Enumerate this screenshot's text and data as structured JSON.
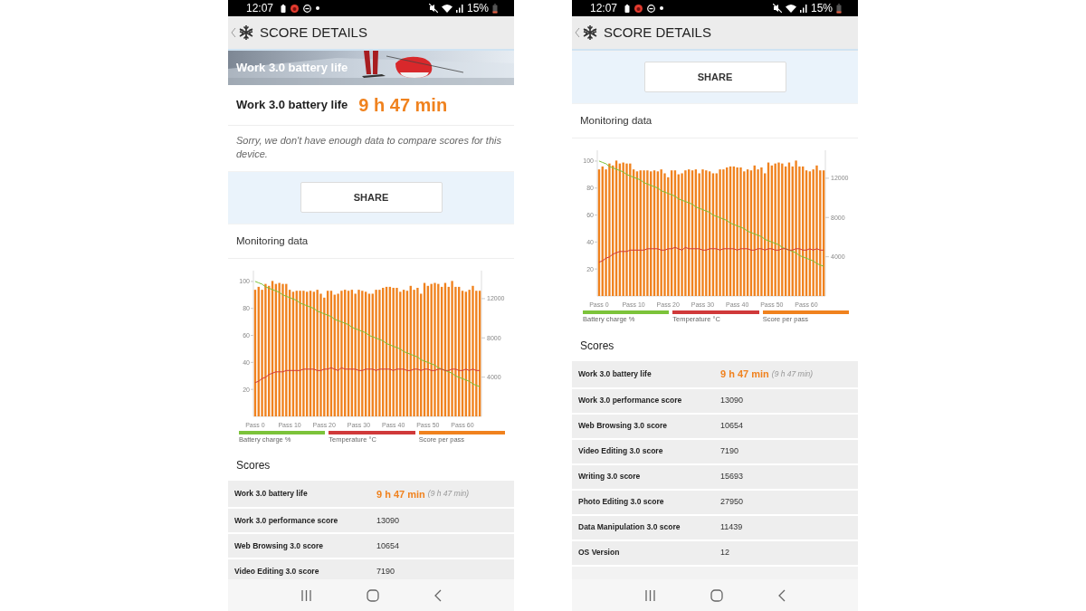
{
  "phones": [
    {
      "status_bar": {
        "time": "12:07",
        "battery": "15%"
      },
      "header": {
        "title": "SCORE DETAILS"
      },
      "sections": [
        {
          "kind": "banner",
          "title": "Work 3.0 battery life"
        },
        {
          "kind": "result",
          "label": "Work 3.0 battery life",
          "value": "9 h 47 min"
        },
        {
          "kind": "note",
          "text": "Sorry, we don't have enough data to compare scores for this device."
        },
        {
          "kind": "share",
          "button": "SHARE"
        },
        {
          "kind": "monitoring",
          "title": "Monitoring data",
          "chart_data": {
            "type": "bar",
            "categories": [
              "Pass 0",
              null,
              null,
              null,
              null,
              null,
              null,
              null,
              null,
              null,
              "Pass 10",
              null,
              null,
              null,
              null,
              null,
              null,
              null,
              null,
              null,
              "Pass 20",
              null,
              null,
              null,
              null,
              null,
              null,
              null,
              null,
              null,
              "Pass 30",
              null,
              null,
              null,
              null,
              null,
              null,
              null,
              null,
              null,
              "Pass 40",
              null,
              null,
              null,
              null,
              null,
              null,
              null,
              null,
              null,
              "Pass 50",
              null,
              null,
              null,
              null,
              null,
              null,
              null,
              null,
              null,
              "Pass 60",
              null,
              null,
              null,
              null,
              null
            ],
            "ylim": [
              0,
              108
            ],
            "yticks": [
              20,
              40,
              60,
              80,
              100
            ],
            "y2lim": [
              0,
              14850
            ],
            "y2ticks": [
              4000,
              8000,
              12000
            ],
            "series": [
              {
                "name": "Battery charge %",
                "color": "#7cc33a",
                "type": "line",
                "values": [
                  100,
                  99,
                  98,
                  96,
                  95,
                  94,
                  93,
                  92,
                  90,
                  89,
                  88,
                  87,
                  86,
                  84,
                  83,
                  82,
                  81,
                  80,
                  78,
                  77,
                  76,
                  75,
                  74,
                  72,
                  71,
                  70,
                  69,
                  68,
                  66,
                  65,
                  64,
                  63,
                  62,
                  60,
                  59,
                  58,
                  57,
                  56,
                  54,
                  53,
                  52,
                  51,
                  50,
                  48,
                  47,
                  46,
                  45,
                  44,
                  42,
                  41,
                  40,
                  39,
                  38,
                  36,
                  35,
                  34,
                  33,
                  32,
                  30,
                  29,
                  28,
                  27,
                  26,
                  24,
                  23,
                  22
                ]
              },
              {
                "name": "Temperature °C",
                "color": "#d0393a",
                "type": "line",
                "values": [
                  25,
                  26,
                  28,
                  29,
                  31,
                  32,
                  33,
                  33,
                  33,
                  34,
                  34,
                  34,
                  34,
                  34,
                  35,
                  35,
                  35,
                  35,
                  34,
                  34,
                  35,
                  35,
                  36,
                  35,
                  34,
                  36,
                  35,
                  35,
                  35,
                  35,
                  34,
                  34,
                  35,
                  35,
                  35,
                  34,
                  35,
                  35,
                  35,
                  35,
                  34,
                  35,
                  35,
                  35,
                  34,
                  34,
                  35,
                  35,
                  34,
                  35,
                  35,
                  34,
                  34,
                  35,
                  35,
                  34,
                  34,
                  35,
                  35,
                  34,
                  34,
                  35,
                  34,
                  35,
                  34,
                  34
                ]
              },
              {
                "name": "Score per pass",
                "color": "#f0821e",
                "type": "bar",
                "axis": "y2",
                "values": [
                  12900,
                  13200,
                  12900,
                  13500,
                  13300,
                  13800,
                  13500,
                  13600,
                  13500,
                  13500,
                  12900,
                  12700,
                  12800,
                  12800,
                  12800,
                  12700,
                  12800,
                  12700,
                  12900,
                  12500,
                  12100,
                  12800,
                  12800,
                  12400,
                  12500,
                  12800,
                  12900,
                  12800,
                  12900,
                  12500,
                  12900,
                  12800,
                  12700,
                  12500,
                  12500,
                  12900,
                  12900,
                  13100,
                  13200,
                  13200,
                  13100,
                  13100,
                  12700,
                  12900,
                  12800,
                  13300,
                  12900,
                  13100,
                  12500,
                  13600,
                  13300,
                  13500,
                  13600,
                  13500,
                  13200,
                  13600,
                  13200,
                  13800,
                  13200,
                  13200,
                  12800,
                  12700,
                  12900,
                  13300,
                  12800,
                  12800
                ]
              }
            ]
          }
        },
        {
          "kind": "scores",
          "title": "Scores",
          "rows": [
            {
              "kind": "duration",
              "label": "Work 3.0 battery life",
              "value": "9 h 47 min",
              "detail": "(9 h 47 min)"
            },
            {
              "kind": "number",
              "label": "Work 3.0 performance score",
              "value": "13090"
            },
            {
              "kind": "number",
              "label": "Web Browsing 3.0 score",
              "value": "10654"
            },
            {
              "kind": "number",
              "label": "Video Editing 3.0 score",
              "value": "7190"
            }
          ]
        }
      ]
    },
    {
      "status_bar": {
        "time": "12:07",
        "battery": "15%"
      },
      "header": {
        "title": "SCORE DETAILS"
      },
      "sections": [
        {
          "kind": "share",
          "button": "SHARE"
        },
        {
          "kind": "monitoring",
          "title": "Monitoring data",
          "chart_data": {
            "type": "bar",
            "categories": [
              "Pass 0",
              null,
              null,
              null,
              null,
              null,
              null,
              null,
              null,
              null,
              "Pass 10",
              null,
              null,
              null,
              null,
              null,
              null,
              null,
              null,
              null,
              "Pass 20",
              null,
              null,
              null,
              null,
              null,
              null,
              null,
              null,
              null,
              "Pass 30",
              null,
              null,
              null,
              null,
              null,
              null,
              null,
              null,
              null,
              "Pass 40",
              null,
              null,
              null,
              null,
              null,
              null,
              null,
              null,
              null,
              "Pass 50",
              null,
              null,
              null,
              null,
              null,
              null,
              null,
              null,
              null,
              "Pass 60",
              null,
              null,
              null,
              null,
              null
            ],
            "ylim": [
              0,
              108
            ],
            "yticks": [
              20,
              40,
              60,
              80,
              100
            ],
            "y2lim": [
              0,
              14850
            ],
            "y2ticks": [
              4000,
              8000,
              12000
            ],
            "series": [
              {
                "name": "Battery charge %",
                "color": "#7cc33a",
                "type": "line",
                "values": [
                  100,
                  99,
                  98,
                  96,
                  95,
                  94,
                  93,
                  92,
                  90,
                  89,
                  88,
                  87,
                  86,
                  84,
                  83,
                  82,
                  81,
                  80,
                  78,
                  77,
                  76,
                  75,
                  74,
                  72,
                  71,
                  70,
                  69,
                  68,
                  66,
                  65,
                  64,
                  63,
                  62,
                  60,
                  59,
                  58,
                  57,
                  56,
                  54,
                  53,
                  52,
                  51,
                  50,
                  48,
                  47,
                  46,
                  45,
                  44,
                  42,
                  41,
                  40,
                  39,
                  38,
                  36,
                  35,
                  34,
                  33,
                  32,
                  30,
                  29,
                  28,
                  27,
                  26,
                  24,
                  23,
                  22
                ]
              },
              {
                "name": "Temperature °C",
                "color": "#d0393a",
                "type": "line",
                "values": [
                  25,
                  26,
                  28,
                  29,
                  31,
                  32,
                  33,
                  33,
                  33,
                  34,
                  34,
                  34,
                  34,
                  34,
                  35,
                  35,
                  35,
                  35,
                  34,
                  34,
                  35,
                  35,
                  36,
                  35,
                  34,
                  36,
                  35,
                  35,
                  35,
                  35,
                  34,
                  34,
                  35,
                  35,
                  35,
                  34,
                  35,
                  35,
                  35,
                  35,
                  34,
                  35,
                  35,
                  35,
                  34,
                  34,
                  35,
                  35,
                  34,
                  35,
                  35,
                  34,
                  34,
                  35,
                  35,
                  34,
                  34,
                  35,
                  35,
                  34,
                  34,
                  35,
                  34,
                  35,
                  34,
                  34
                ]
              },
              {
                "name": "Score per pass",
                "color": "#f0821e",
                "type": "bar",
                "axis": "y2",
                "values": [
                  12900,
                  13200,
                  12900,
                  13500,
                  13300,
                  13800,
                  13500,
                  13600,
                  13500,
                  13500,
                  12900,
                  12700,
                  12800,
                  12800,
                  12800,
                  12700,
                  12800,
                  12700,
                  12900,
                  12500,
                  12100,
                  12800,
                  12800,
                  12400,
                  12500,
                  12800,
                  12900,
                  12800,
                  12900,
                  12500,
                  12900,
                  12800,
                  12700,
                  12500,
                  12500,
                  12900,
                  12900,
                  13100,
                  13200,
                  13200,
                  13100,
                  13100,
                  12700,
                  12900,
                  12800,
                  13300,
                  12900,
                  13100,
                  12500,
                  13600,
                  13300,
                  13500,
                  13600,
                  13500,
                  13200,
                  13600,
                  13200,
                  13800,
                  13200,
                  13200,
                  12800,
                  12700,
                  12900,
                  13300,
                  12800,
                  12800
                ]
              }
            ]
          }
        },
        {
          "kind": "scores",
          "title": "Scores",
          "rows": [
            {
              "kind": "duration",
              "label": "Work 3.0 battery life",
              "value": "9 h 47 min",
              "detail": "(9 h 47 min)"
            },
            {
              "kind": "number",
              "label": "Work 3.0 performance score",
              "value": "13090"
            },
            {
              "kind": "number",
              "label": "Web Browsing 3.0 score",
              "value": "10654"
            },
            {
              "kind": "number",
              "label": "Video Editing 3.0 score",
              "value": "7190"
            },
            {
              "kind": "number",
              "label": "Writing 3.0 score",
              "value": "15693"
            },
            {
              "kind": "number",
              "label": "Photo Editing 3.0 score",
              "value": "27950"
            },
            {
              "kind": "number",
              "label": "Data Manipulation 3.0 score",
              "value": "11439"
            },
            {
              "kind": "number",
              "label": "OS Version",
              "value": "12"
            }
          ]
        }
      ]
    }
  ]
}
